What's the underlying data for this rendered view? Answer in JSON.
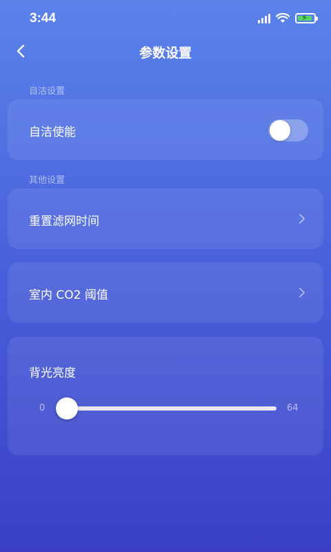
{
  "status_bar": {
    "time": "3:44",
    "icons": [
      "cellular-signal-icon",
      "wifi-icon",
      "battery-charging-icon"
    ],
    "battery_color": "#57d36b"
  },
  "nav": {
    "title": "参数设置",
    "back_icon": "chevron-left-icon"
  },
  "sections": {
    "self_clean": {
      "label": "自洁设置"
    },
    "other": {
      "label": "其他设置"
    }
  },
  "self_clean_enable": {
    "label": "自洁使能",
    "enabled": false
  },
  "reset_filter_time": {
    "label": "重置滤网时间",
    "icon": "chevron-right-icon"
  },
  "co2_threshold": {
    "label": "室内 CO2 阈值",
    "icon": "chevron-right-icon"
  },
  "backlight": {
    "label": "背光亮度",
    "min": "0",
    "max": "64",
    "value": 0
  },
  "colors": {
    "gradient_top": "#5a83ea",
    "gradient_bottom": "#3a3fc6",
    "card": "rgba(255,255,255,0.08)"
  }
}
